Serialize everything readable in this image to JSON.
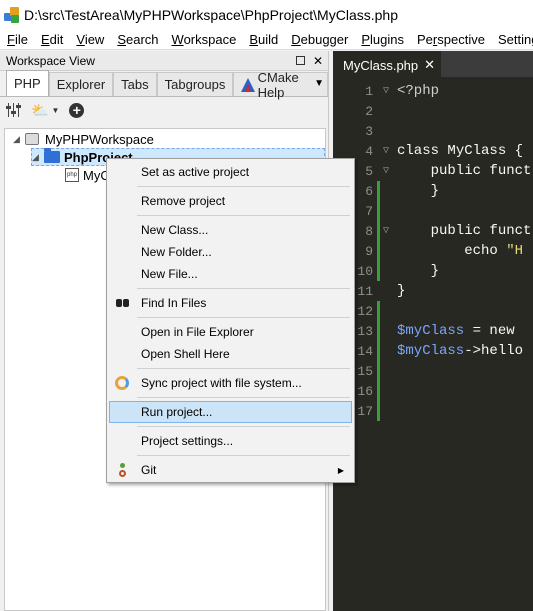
{
  "window": {
    "title": "D:\\src\\TestArea\\MyPHPWorkspace\\PhpProject\\MyClass.php"
  },
  "menubar": [
    {
      "u": "F",
      "rest": "ile"
    },
    {
      "u": "E",
      "rest": "dit"
    },
    {
      "u": "V",
      "rest": "iew"
    },
    {
      "u": "S",
      "rest": "earch"
    },
    {
      "u": "W",
      "rest": "orkspace"
    },
    {
      "u": "B",
      "rest": "uild"
    },
    {
      "u": "D",
      "rest": "ebugger"
    },
    {
      "u": "P",
      "rest": "lugins"
    },
    {
      "u": "",
      "pre": "Pe",
      "mid": "r",
      "rest": "spective"
    },
    {
      "u": "",
      "pre": "Settin",
      "mid": "g",
      "rest": "s"
    },
    {
      "u": "Pl",
      "rest": ""
    }
  ],
  "workspace": {
    "header_title": "Workspace View",
    "tabs": [
      "PHP",
      "Explorer",
      "Tabs",
      "Tabgroups",
      "CMake Help"
    ],
    "active_tab": "PHP",
    "tree": {
      "workspace_name": "MyPHPWorkspace",
      "project_name": "PhpProject",
      "file_name": "MyClass.php"
    }
  },
  "editor": {
    "tab_label": "MyClass.php",
    "lines": [
      {
        "n": "1",
        "fold": "▽",
        "mod": false,
        "parts": [
          {
            "c": "tag",
            "t": "<?php"
          }
        ]
      },
      {
        "n": "2",
        "fold": "",
        "mod": false,
        "parts": []
      },
      {
        "n": "3",
        "fold": "",
        "mod": false,
        "parts": []
      },
      {
        "n": "4",
        "fold": "▽",
        "mod": false,
        "parts": [
          {
            "c": "kw",
            "t": "class "
          },
          {
            "c": "kw",
            "t": "MyClass {"
          }
        ]
      },
      {
        "n": "5",
        "fold": "▽",
        "mod": false,
        "parts": [
          {
            "c": "kw",
            "t": "    public funct"
          }
        ]
      },
      {
        "n": "6",
        "fold": "",
        "mod": true,
        "parts": [
          {
            "c": "kw",
            "t": "    }"
          }
        ]
      },
      {
        "n": "7",
        "fold": "",
        "mod": true,
        "parts": []
      },
      {
        "n": "8",
        "fold": "▽",
        "mod": true,
        "parts": [
          {
            "c": "kw",
            "t": "    public funct"
          }
        ]
      },
      {
        "n": "9",
        "fold": "",
        "mod": true,
        "parts": [
          {
            "c": "kw",
            "t": "        echo "
          },
          {
            "c": "str",
            "t": "\"H"
          }
        ]
      },
      {
        "n": "10",
        "fold": "",
        "mod": true,
        "parts": [
          {
            "c": "kw",
            "t": "    }"
          }
        ]
      },
      {
        "n": "11",
        "fold": "",
        "mod": false,
        "parts": [
          {
            "c": "kw",
            "t": "}"
          }
        ]
      },
      {
        "n": "12",
        "fold": "",
        "mod": true,
        "parts": []
      },
      {
        "n": "13",
        "fold": "",
        "mod": true,
        "parts": [
          {
            "c": "var",
            "t": "$myClass"
          },
          {
            "c": "kw",
            "t": " = new "
          }
        ]
      },
      {
        "n": "14",
        "fold": "",
        "mod": true,
        "parts": [
          {
            "c": "var",
            "t": "$myClass"
          },
          {
            "c": "kw",
            "t": "->hello"
          }
        ]
      },
      {
        "n": "15",
        "fold": "",
        "mod": true,
        "parts": []
      },
      {
        "n": "16",
        "fold": "",
        "mod": true,
        "parts": []
      },
      {
        "n": "17",
        "fold": "",
        "mod": true,
        "parts": []
      }
    ]
  },
  "context_menu": {
    "set_active": "Set as active project",
    "remove": "Remove project",
    "new_class": "New Class...",
    "new_folder": "New Folder...",
    "new_file": "New File...",
    "find_in_files": "Find In Files",
    "open_explorer": "Open in File Explorer",
    "open_shell": "Open Shell Here",
    "sync": "Sync project with file system...",
    "run": "Run project...",
    "settings": "Project settings...",
    "git": "Git"
  },
  "colors": {
    "editor_bg": "#272822",
    "selection": "#cce4f7",
    "modified_marker": "#3a9e3a"
  }
}
